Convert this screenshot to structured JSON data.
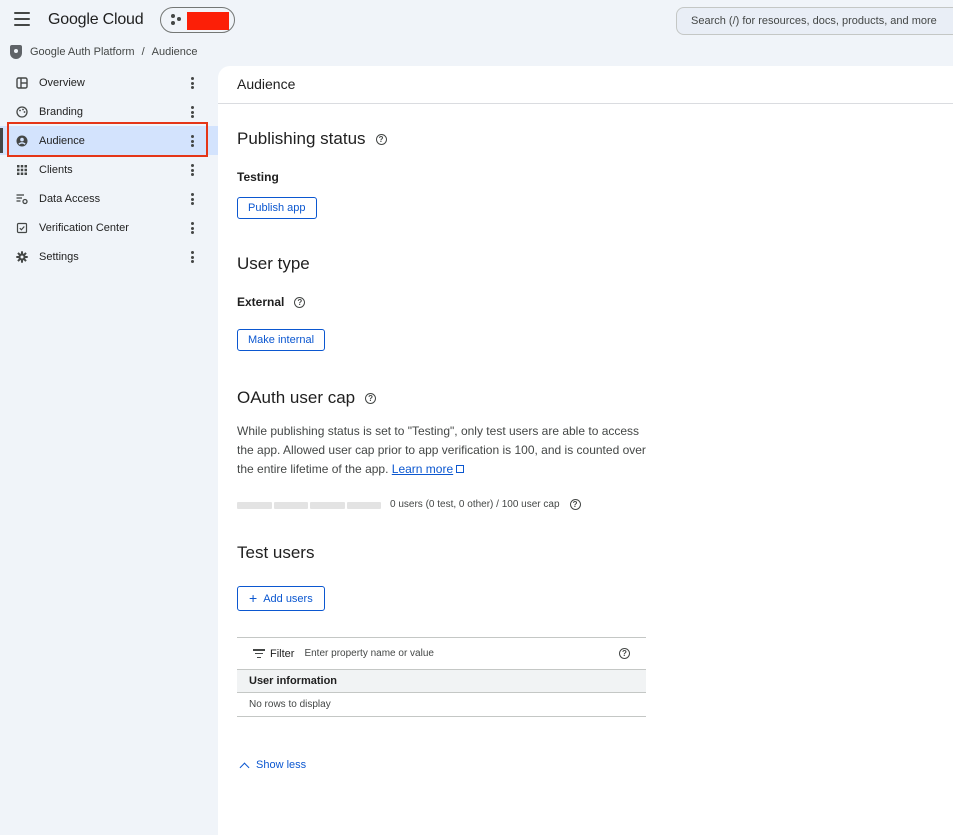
{
  "topbar": {
    "brand": "Google Cloud",
    "search_placeholder": "Search (/) for resources, docs, products, and more"
  },
  "breadcrumb": {
    "items": [
      "Google Auth Platform",
      "Audience"
    ],
    "separator": "/"
  },
  "sidebar": {
    "items": [
      {
        "label": "Overview",
        "icon": "dashboard-icon"
      },
      {
        "label": "Branding",
        "icon": "palette-icon"
      },
      {
        "label": "Audience",
        "icon": "account-circle-icon",
        "active": true
      },
      {
        "label": "Clients",
        "icon": "grid-icon"
      },
      {
        "label": "Data Access",
        "icon": "settings-list-icon"
      },
      {
        "label": "Verification Center",
        "icon": "checkbox-icon"
      },
      {
        "label": "Settings",
        "icon": "gear-icon"
      }
    ]
  },
  "main": {
    "title": "Audience",
    "publishing": {
      "heading": "Publishing status",
      "status": "Testing",
      "button": "Publish app"
    },
    "user_type": {
      "heading": "User type",
      "value": "External",
      "button": "Make internal"
    },
    "oauth_cap": {
      "heading": "OAuth user cap",
      "description": "While publishing status is set to \"Testing\", only test users are able to access the app. Allowed user cap prior to app verification is 100, and is counted over the entire lifetime of the app.",
      "link": "Learn more",
      "progress_value": 0,
      "progress_max": 100,
      "progress_text": "0 users (0 test, 0 other) / 100 user cap"
    },
    "test_users": {
      "heading": "Test users",
      "add_button": "Add users",
      "filter_label": "Filter",
      "filter_placeholder": "Enter property name or value",
      "column_header": "User information",
      "empty_text": "No rows to display",
      "show_less": "Show less"
    }
  },
  "colors": {
    "accent": "#0b57d0",
    "active_nav": "#d3e3fd",
    "highlight_box": "#e53517",
    "redaction": "#fc1f07"
  }
}
